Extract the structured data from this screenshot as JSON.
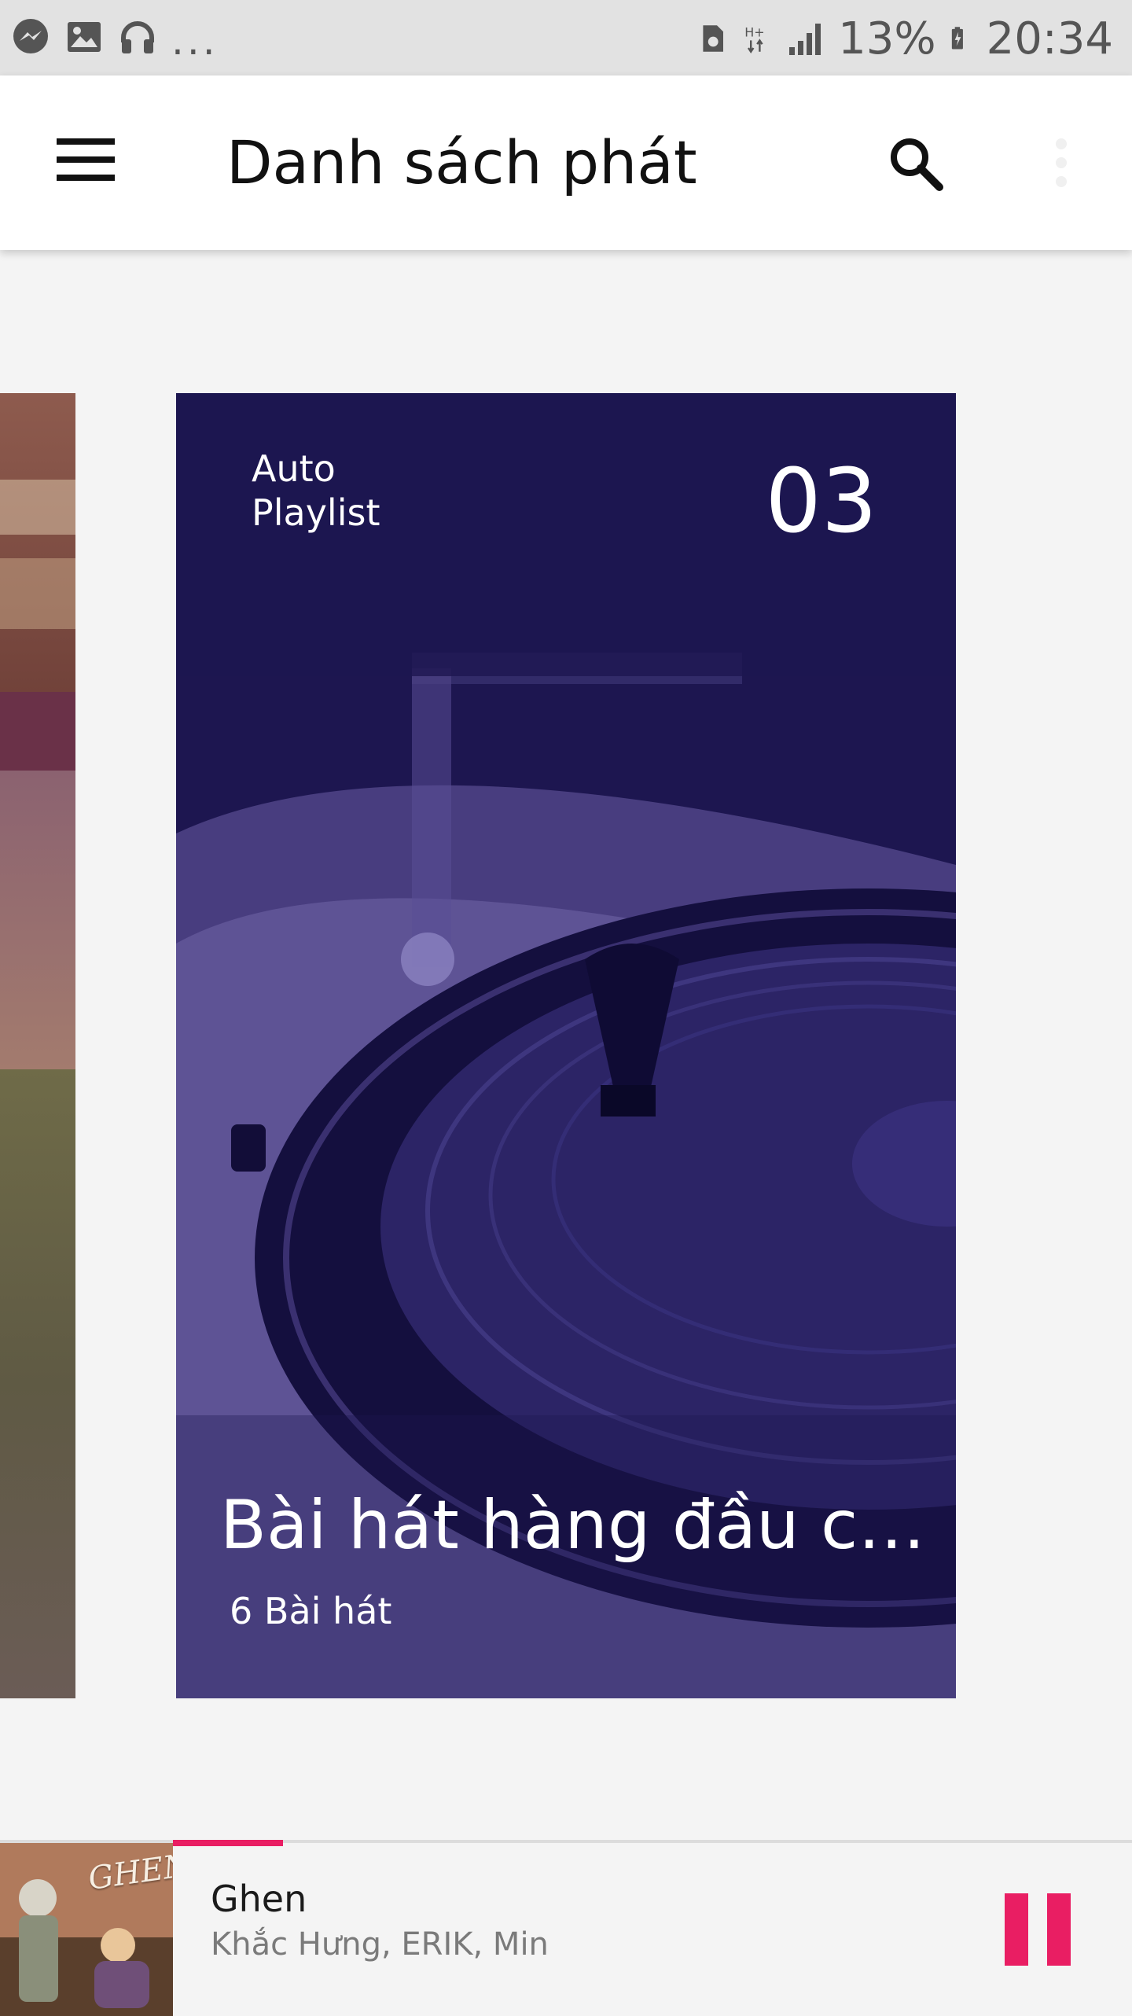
{
  "status_bar": {
    "battery": "13%",
    "time": "20:34",
    "notification_icons": [
      "messenger-icon",
      "gallery-icon",
      "headphones-icon"
    ],
    "more_notifications": "...",
    "system_icons": [
      "sim-icon",
      "hplus-icon",
      "signal-icon",
      "battery-icon"
    ]
  },
  "app_bar": {
    "title": "Danh sách phát",
    "menu_icon": "hamburger-menu-icon",
    "search_icon": "search-icon",
    "more_icon": "more-vertical-icon"
  },
  "carousel": {
    "current_card": {
      "type_line1": "Auto",
      "type_line2": "Playlist",
      "number": "03",
      "title": "Bài hát hàng đầu của …",
      "count": "6 Bài hát",
      "background_color": "#1d1650"
    }
  },
  "player": {
    "track_title": "Ghen",
    "track_artist": "Khắc Hưng, ERIK, Min",
    "album_label": "GHEN",
    "progress": 0.115,
    "accent_color": "#e91e63",
    "pause_icon": "pause-icon"
  }
}
